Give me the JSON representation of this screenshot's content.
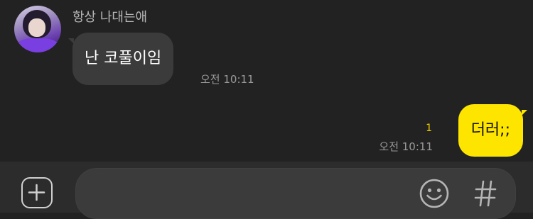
{
  "chat": {
    "incoming": {
      "sender": "항상 나대는애",
      "message": "난 코풀이임",
      "time": "오전 10:11"
    },
    "outgoing": {
      "message": "더러;;",
      "unread_count": "1",
      "time": "오전 10:11"
    }
  },
  "input_bar": {
    "attach_icon": "plus-square-icon",
    "message_value": "",
    "emoji_icon": "smiley-icon",
    "hash_icon": "hash-icon"
  },
  "colors": {
    "background": "#222222",
    "incoming_bubble": "#3b3b3b",
    "outgoing_bubble": "#fee500",
    "unread_count": "#f2d100",
    "input_bar": "#2c2c2c"
  }
}
